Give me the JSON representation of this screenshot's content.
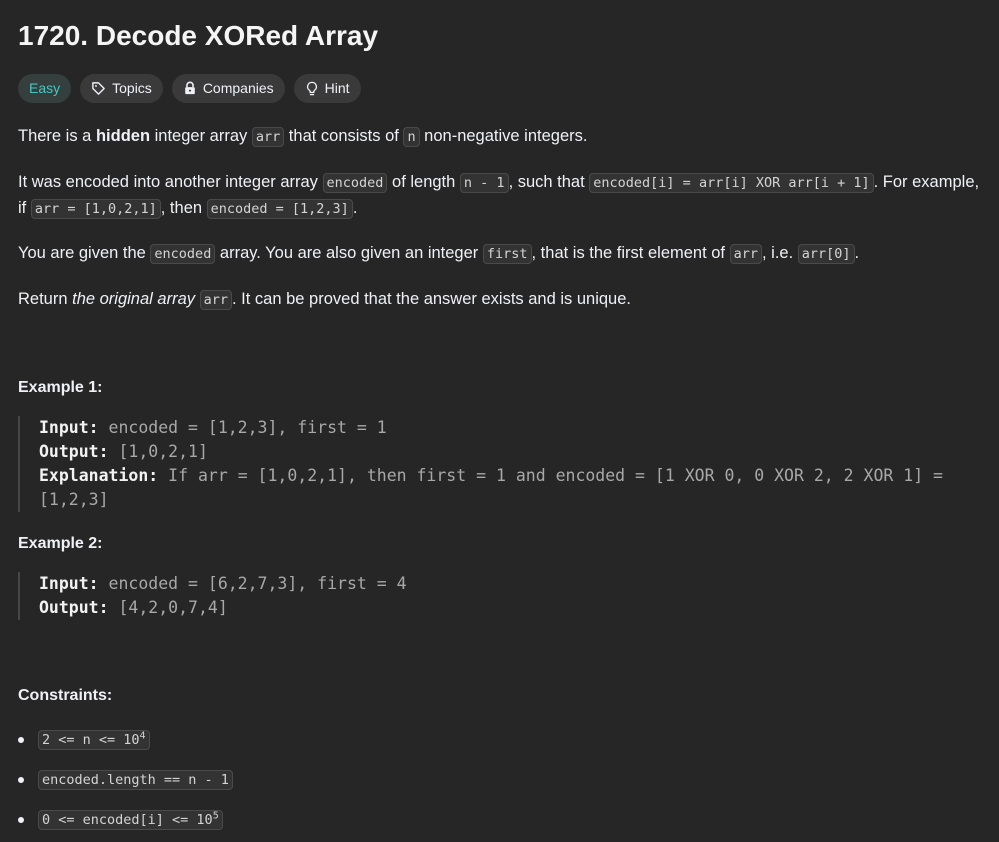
{
  "problem": {
    "title": "1720. Decode XORed Array",
    "difficulty": "Easy",
    "tags": [
      {
        "label": "Topics",
        "icon": "tag-icon"
      },
      {
        "label": "Companies",
        "icon": "lock-icon"
      },
      {
        "label": "Hint",
        "icon": "lightbulb-icon"
      }
    ]
  },
  "description": {
    "p1": {
      "t1": "There is a ",
      "bold": "hidden",
      "t2": " integer array ",
      "c1": "arr",
      "t3": " that consists of ",
      "c2": "n",
      "t4": " non-negative integers."
    },
    "p2": {
      "t1": "It was encoded into another integer array ",
      "c1": "encoded",
      "t2": " of length ",
      "c2": "n - 1",
      "t3": ", such that ",
      "c3": "encoded[i] = arr[i] XOR arr[i + 1]",
      "t4": ". For example, if ",
      "c4": "arr = [1,0,2,1]",
      "t5": ", then ",
      "c5": "encoded = [1,2,3]",
      "t6": "."
    },
    "p3": {
      "t1": "You are given the ",
      "c1": "encoded",
      "t2": " array. You are also given an integer ",
      "c2": "first",
      "t3": ", that is the first element of ",
      "c3": "arr",
      "t4": ", i.e. ",
      "c4": "arr[0]",
      "t5": "."
    },
    "p4": {
      "t1": "Return ",
      "italic": "the original array",
      "t2": " ",
      "c1": "arr",
      "t3": ". It can be proved that the answer exists and is unique."
    }
  },
  "examples": [
    {
      "title": "Example 1:",
      "input_label": "Input:",
      "input": " encoded = [1,2,3], first = 1",
      "output_label": "Output:",
      "output": " [1,0,2,1]",
      "explanation_label": "Explanation:",
      "explanation": " If arr = [1,0,2,1], then first = 1 and encoded = [1 XOR 0, 0 XOR 2, 2 XOR 1] = [1,2,3]"
    },
    {
      "title": "Example 2:",
      "input_label": "Input:",
      "input": " encoded = [6,2,7,3], first = 4",
      "output_label": "Output:",
      "output": " [4,2,0,7,4]"
    }
  ],
  "constraints": {
    "title": "Constraints:",
    "items": [
      {
        "base": "2 <= n <= 10",
        "sup": "4"
      },
      {
        "base": "encoded.length == n - 1",
        "sup": ""
      },
      {
        "base": "0 <= encoded[i] <= 10",
        "sup": "5"
      }
    ]
  }
}
